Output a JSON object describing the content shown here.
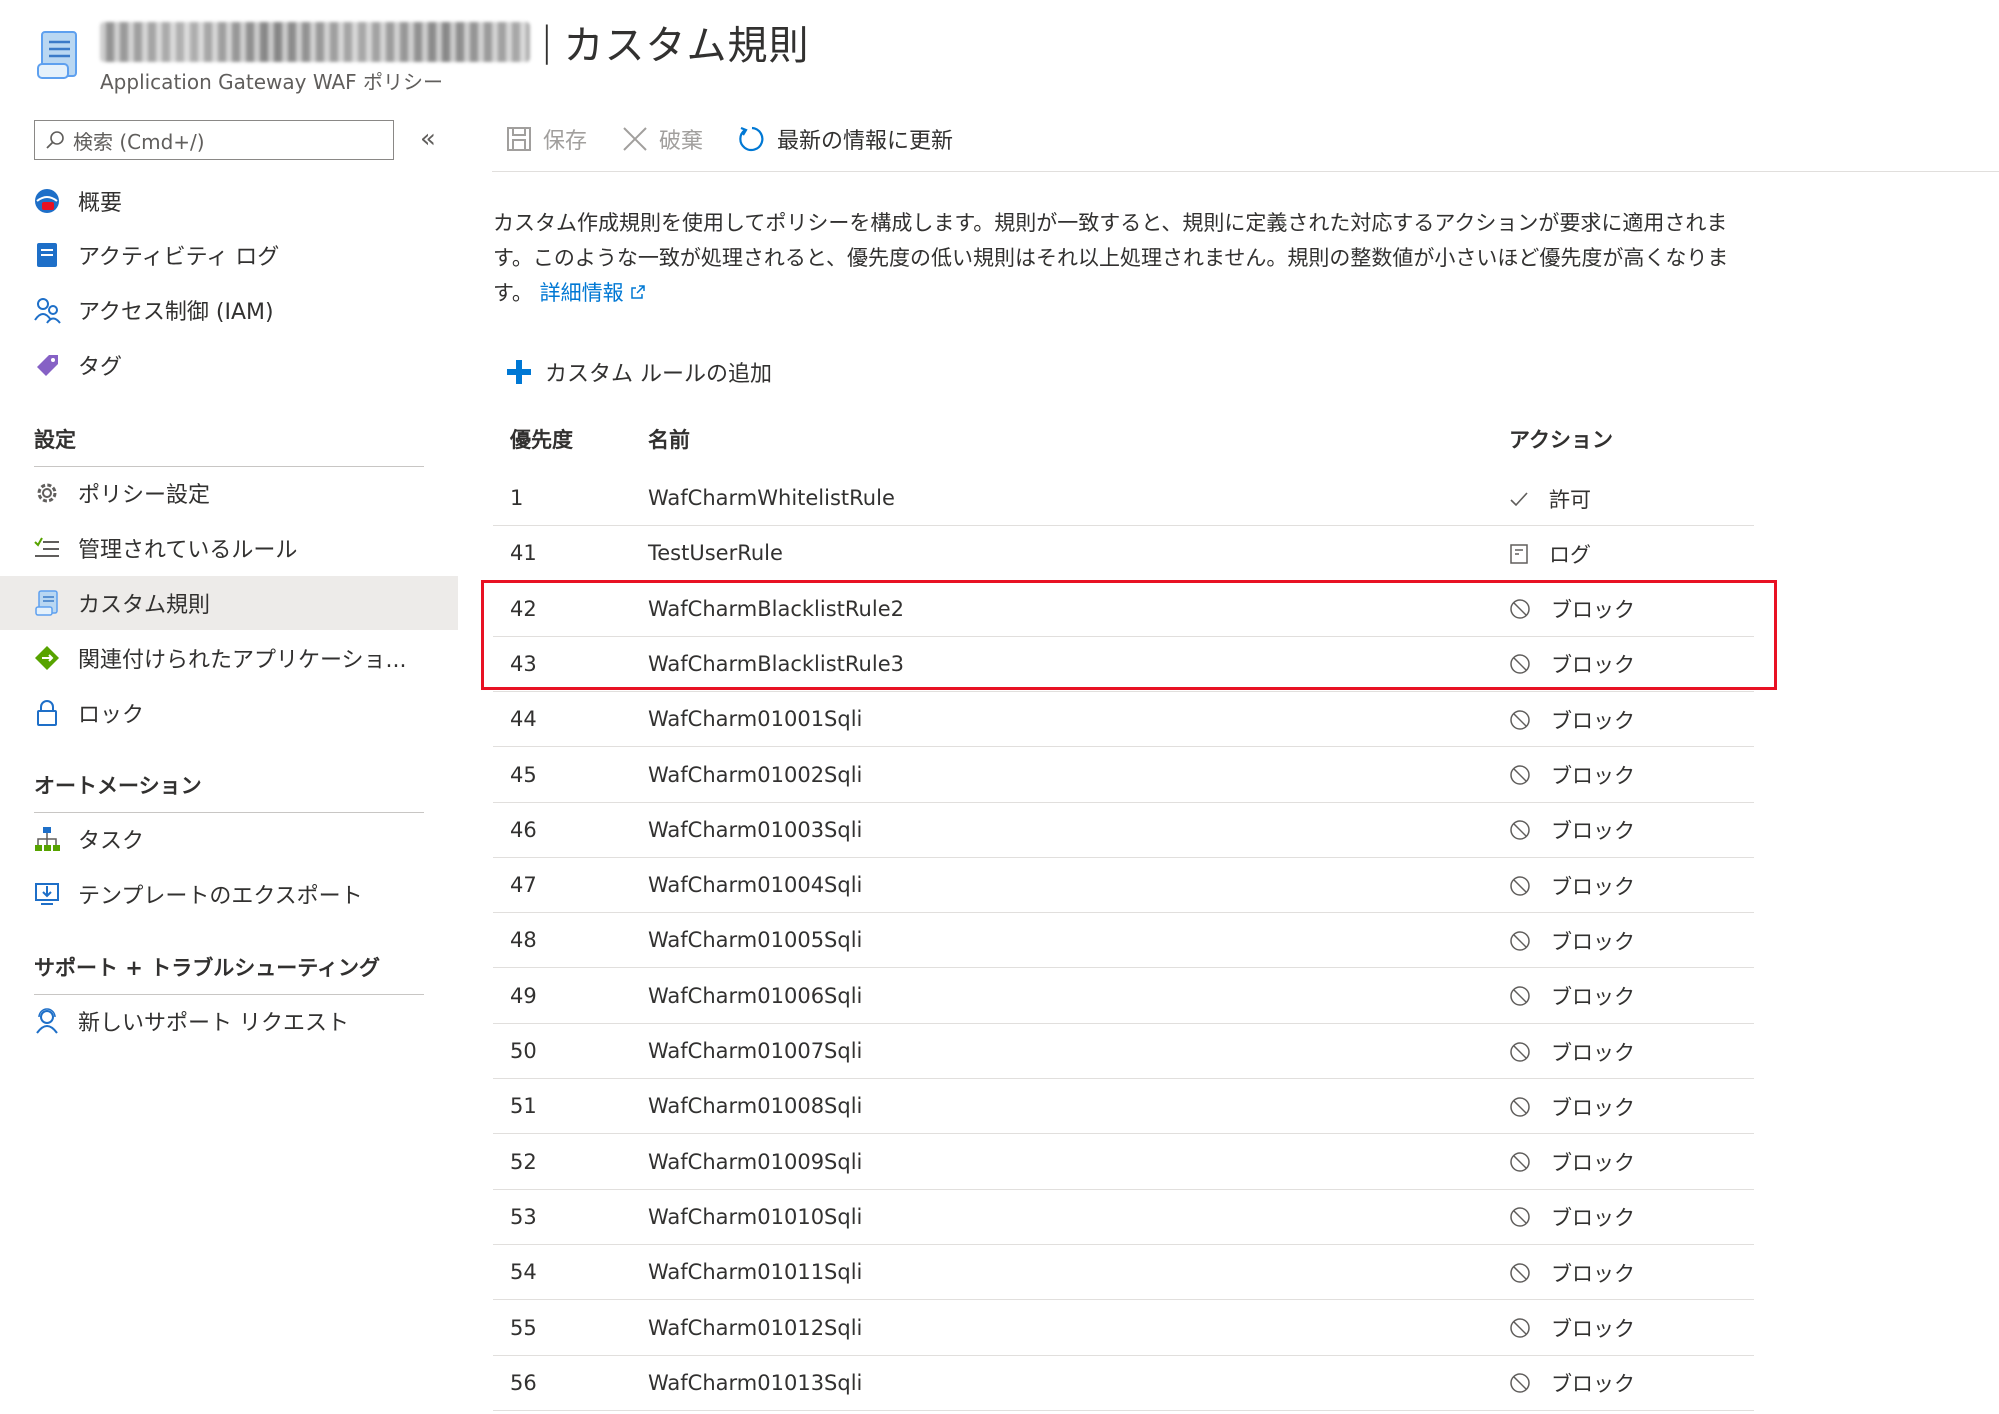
{
  "header": {
    "title": "カスタム規則",
    "separator": "|",
    "subtitle": "Application Gateway WAF ポリシー"
  },
  "sidebar": {
    "search_placeholder": "検索 (Cmd+/)",
    "collapse_glyph": "«",
    "items_top": [
      {
        "label": "概要",
        "icon": "overview-globe-icon"
      },
      {
        "label": "アクティビティ ログ",
        "icon": "activity-log-icon"
      },
      {
        "label": "アクセス制御 (IAM)",
        "icon": "iam-users-icon"
      },
      {
        "label": "タグ",
        "icon": "tag-icon"
      }
    ],
    "section_settings": "設定",
    "items_settings": [
      {
        "label": "ポリシー設定",
        "icon": "gear-icon"
      },
      {
        "label": "管理されているルール",
        "icon": "managed-rules-icon"
      },
      {
        "label": "カスタム規則",
        "icon": "custom-rules-icon"
      },
      {
        "label": "関連付けられたアプリケーショ...",
        "icon": "associated-apps-icon"
      },
      {
        "label": "ロック",
        "icon": "lock-icon"
      }
    ],
    "section_automation": "オートメーション",
    "items_automation": [
      {
        "label": "タスク",
        "icon": "tasks-icon"
      },
      {
        "label": "テンプレートのエクスポート",
        "icon": "export-template-icon"
      }
    ],
    "section_support": "サポート + トラブルシューティング",
    "items_support": [
      {
        "label": "新しいサポート リクエスト",
        "icon": "support-request-icon"
      }
    ]
  },
  "toolbar": {
    "save": "保存",
    "discard": "破棄",
    "refresh": "最新の情報に更新"
  },
  "description": {
    "text": "カスタム作成規則を使用してポリシーを構成します。規則が一致すると、規則に定義された対応するアクションが要求に適用されます。このような一致が処理されると、優先度の低い規則はそれ以上処理されません。規則の整数値が小さいほど優先度が高くなります。",
    "link": "詳細情報"
  },
  "add_rule": "カスタム ルールの追加",
  "table": {
    "columns": [
      "優先度",
      "名前",
      "アクション"
    ],
    "rows": [
      {
        "priority": "1",
        "name": "WafCharmWhitelistRule",
        "action": "許可",
        "icon": "allow"
      },
      {
        "priority": "41",
        "name": "TestUserRule",
        "action": "ログ",
        "icon": "log"
      },
      {
        "priority": "42",
        "name": "WafCharmBlacklistRule2",
        "action": "ブロック",
        "icon": "block"
      },
      {
        "priority": "43",
        "name": "WafCharmBlacklistRule3",
        "action": "ブロック",
        "icon": "block"
      },
      {
        "priority": "44",
        "name": "WafCharm01001Sqli",
        "action": "ブロック",
        "icon": "block"
      },
      {
        "priority": "45",
        "name": "WafCharm01002Sqli",
        "action": "ブロック",
        "icon": "block"
      },
      {
        "priority": "46",
        "name": "WafCharm01003Sqli",
        "action": "ブロック",
        "icon": "block"
      },
      {
        "priority": "47",
        "name": "WafCharm01004Sqli",
        "action": "ブロック",
        "icon": "block"
      },
      {
        "priority": "48",
        "name": "WafCharm01005Sqli",
        "action": "ブロック",
        "icon": "block"
      },
      {
        "priority": "49",
        "name": "WafCharm01006Sqli",
        "action": "ブロック",
        "icon": "block"
      },
      {
        "priority": "50",
        "name": "WafCharm01007Sqli",
        "action": "ブロック",
        "icon": "block"
      },
      {
        "priority": "51",
        "name": "WafCharm01008Sqli",
        "action": "ブロック",
        "icon": "block"
      },
      {
        "priority": "52",
        "name": "WafCharm01009Sqli",
        "action": "ブロック",
        "icon": "block"
      },
      {
        "priority": "53",
        "name": "WafCharm01010Sqli",
        "action": "ブロック",
        "icon": "block"
      },
      {
        "priority": "54",
        "name": "WafCharm01011Sqli",
        "action": "ブロック",
        "icon": "block"
      },
      {
        "priority": "55",
        "name": "WafCharm01012Sqli",
        "action": "ブロック",
        "icon": "block"
      },
      {
        "priority": "56",
        "name": "WafCharm01013Sqli",
        "action": "ブロック",
        "icon": "block"
      }
    ]
  },
  "colors": {
    "accent": "#0078d4",
    "highlight_border": "#e81123",
    "active_nav": "#edebe9"
  }
}
